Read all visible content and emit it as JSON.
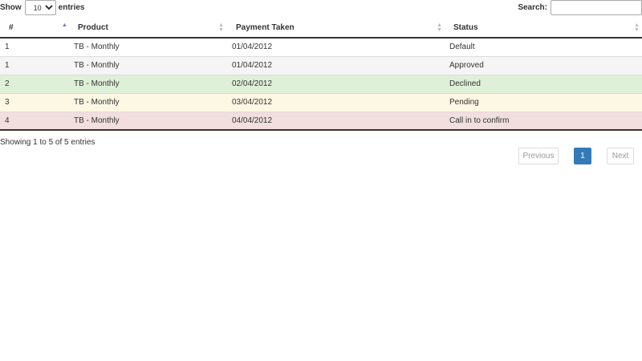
{
  "controls": {
    "show_label": "Show",
    "page_length": "10",
    "page_length_options": [
      "10"
    ],
    "entries_label": "entries",
    "search_label": "Search:",
    "search_value": ""
  },
  "table": {
    "columns": [
      {
        "label": "#",
        "sort": "ascending"
      },
      {
        "label": "Product",
        "sort": "none"
      },
      {
        "label": "Payment Taken",
        "sort": "none"
      },
      {
        "label": "Status",
        "sort": "none"
      }
    ],
    "rows": [
      {
        "num": "1",
        "product": "TB - Monthly",
        "payment": "01/04/2012",
        "status": "Default",
        "bg": "#ffffff"
      },
      {
        "num": "1",
        "product": "TB - Monthly",
        "payment": "01/04/2012",
        "status": "Approved",
        "bg": "#f5f5f5"
      },
      {
        "num": "2",
        "product": "TB - Monthly",
        "payment": "02/04/2012",
        "status": "Declined",
        "bg": "#dff0d8"
      },
      {
        "num": "3",
        "product": "TB - Monthly",
        "payment": "03/04/2012",
        "status": "Pending",
        "bg": "#fcf8e3"
      },
      {
        "num": "4",
        "product": "TB - Monthly",
        "payment": "04/04/2012",
        "status": "Call in to confirm",
        "bg": "#f2dede"
      }
    ]
  },
  "info": "Showing 1 to 5 of 5 entries",
  "pagination": {
    "previous": "Previous",
    "current": "1",
    "next": "Next",
    "active_color": "#337ab7"
  }
}
